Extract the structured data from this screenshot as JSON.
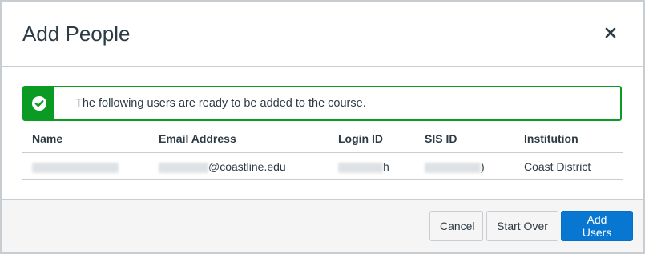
{
  "dialog": {
    "title": "Add People",
    "close_icon": "close-icon"
  },
  "alert": {
    "icon": "check-circle-icon",
    "message": "The following users are ready to be added to the course.",
    "color": "#0b9a23"
  },
  "table": {
    "columns": [
      "Name",
      "Email Address",
      "Login ID",
      "SIS ID",
      "Institution"
    ],
    "rows": [
      {
        "name": "",
        "email_suffix": "@coastline.edu",
        "login_suffix": "h",
        "sis_suffix": ")",
        "institution": "Coast District"
      }
    ]
  },
  "footer": {
    "cancel_label": "Cancel",
    "start_over_label": "Start Over",
    "add_users_label": "Add Users",
    "primary_color": "#0877d2"
  }
}
